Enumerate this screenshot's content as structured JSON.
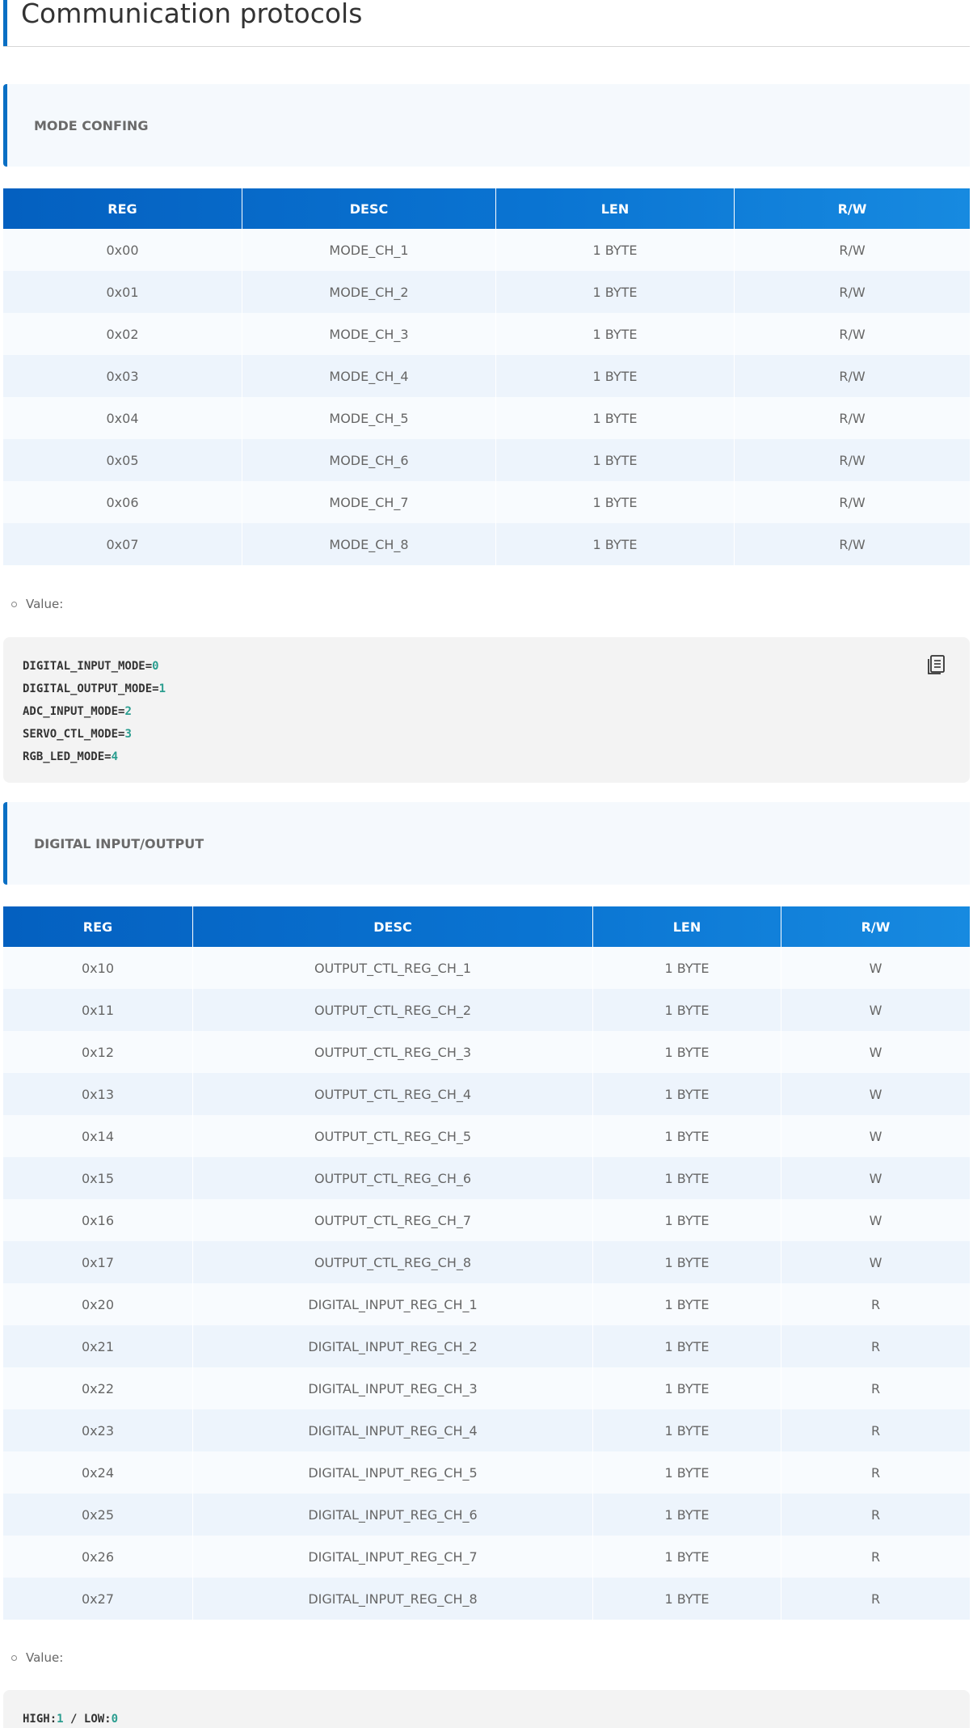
{
  "page": {
    "title": "Communication protocols"
  },
  "sections": {
    "mode_config": {
      "heading": "MODE CONFING",
      "columns": [
        "REG",
        "DESC",
        "LEN",
        "R/W"
      ],
      "rows": [
        [
          "0x00",
          "MODE_CH_1",
          "1 BYTE",
          "R/W"
        ],
        [
          "0x01",
          "MODE_CH_2",
          "1 BYTE",
          "R/W"
        ],
        [
          "0x02",
          "MODE_CH_3",
          "1 BYTE",
          "R/W"
        ],
        [
          "0x03",
          "MODE_CH_4",
          "1 BYTE",
          "R/W"
        ],
        [
          "0x04",
          "MODE_CH_5",
          "1 BYTE",
          "R/W"
        ],
        [
          "0x05",
          "MODE_CH_6",
          "1 BYTE",
          "R/W"
        ],
        [
          "0x06",
          "MODE_CH_7",
          "1 BYTE",
          "R/W"
        ],
        [
          "0x07",
          "MODE_CH_8",
          "1 BYTE",
          "R/W"
        ]
      ],
      "value_label": "Value:",
      "code": [
        {
          "key": "DIGITAL_INPUT_MODE=",
          "num": "0"
        },
        {
          "key": "DIGITAL_OUTPUT_MODE=",
          "num": "1"
        },
        {
          "key": "ADC_INPUT_MODE=",
          "num": "2"
        },
        {
          "key": "SERVO_CTL_MODE=",
          "num": "3"
        },
        {
          "key": "RGB_LED_MODE=",
          "num": "4"
        }
      ],
      "copy_icon": "copy-icon"
    },
    "digital_io": {
      "heading": "DIGITAL INPUT/OUTPUT",
      "columns": [
        "REG",
        "DESC",
        "LEN",
        "R/W"
      ],
      "rows": [
        [
          "0x10",
          "OUTPUT_CTL_REG_CH_1",
          "1 BYTE",
          "W"
        ],
        [
          "0x11",
          "OUTPUT_CTL_REG_CH_2",
          "1 BYTE",
          "W"
        ],
        [
          "0x12",
          "OUTPUT_CTL_REG_CH_3",
          "1 BYTE",
          "W"
        ],
        [
          "0x13",
          "OUTPUT_CTL_REG_CH_4",
          "1 BYTE",
          "W"
        ],
        [
          "0x14",
          "OUTPUT_CTL_REG_CH_5",
          "1 BYTE",
          "W"
        ],
        [
          "0x15",
          "OUTPUT_CTL_REG_CH_6",
          "1 BYTE",
          "W"
        ],
        [
          "0x16",
          "OUTPUT_CTL_REG_CH_7",
          "1 BYTE",
          "W"
        ],
        [
          "0x17",
          "OUTPUT_CTL_REG_CH_8",
          "1 BYTE",
          "W"
        ],
        [
          "0x20",
          "DIGITAL_INPUT_REG_CH_1",
          "1 BYTE",
          "R"
        ],
        [
          "0x21",
          "DIGITAL_INPUT_REG_CH_2",
          "1 BYTE",
          "R"
        ],
        [
          "0x22",
          "DIGITAL_INPUT_REG_CH_3",
          "1 BYTE",
          "R"
        ],
        [
          "0x23",
          "DIGITAL_INPUT_REG_CH_4",
          "1 BYTE",
          "R"
        ],
        [
          "0x24",
          "DIGITAL_INPUT_REG_CH_5",
          "1 BYTE",
          "R"
        ],
        [
          "0x25",
          "DIGITAL_INPUT_REG_CH_6",
          "1 BYTE",
          "R"
        ],
        [
          "0x26",
          "DIGITAL_INPUT_REG_CH_7",
          "1 BYTE",
          "R"
        ],
        [
          "0x27",
          "DIGITAL_INPUT_REG_CH_8",
          "1 BYTE",
          "R"
        ]
      ],
      "value_label": "Value:",
      "code_parts": {
        "high_key": "HIGH:",
        "high_num": "1",
        "sep": " / ",
        "low_key": "LOW:",
        "low_num": "0"
      }
    }
  },
  "colors": {
    "accent": "#0a6fc4",
    "code_number": "#2a9d8f"
  }
}
